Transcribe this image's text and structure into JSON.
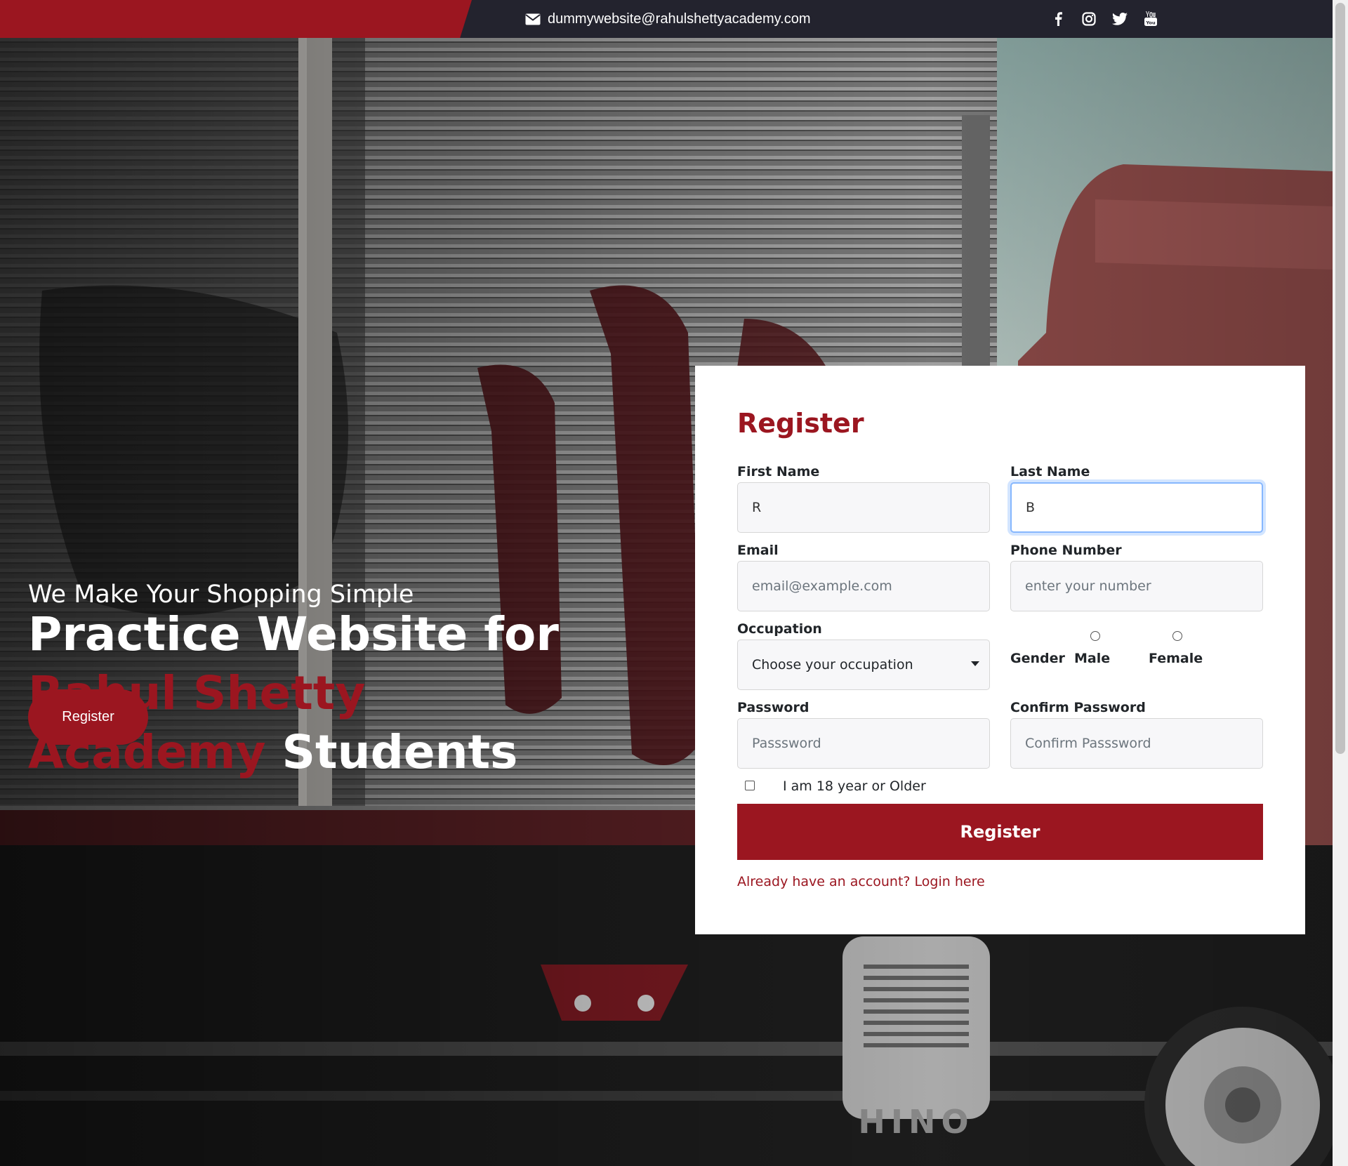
{
  "topbar": {
    "email": "dummywebsite@rahulshettyacademy.com",
    "socials": [
      "facebook",
      "instagram",
      "twitter",
      "youtube"
    ]
  },
  "hero": {
    "subtitle": "We Make Your Shopping Simple",
    "title_part1": "Practice Website for ",
    "title_accent": "Rahul Shetty Academy",
    "title_part2": " Students",
    "register_button": "Register"
  },
  "form": {
    "title": "Register",
    "first_name_label": "First Name",
    "first_name_value": "R",
    "last_name_label": "Last Name",
    "last_name_value": "B",
    "email_label": "Email",
    "email_placeholder": "email@example.com",
    "phone_label": "Phone Number",
    "phone_placeholder": "enter your number",
    "occupation_label": "Occupation",
    "occupation_selected": "Choose your occupation",
    "gender_label": "Gender",
    "gender_options": [
      "Male",
      "Female"
    ],
    "password_label": "Password",
    "password_placeholder": "Passsword",
    "confirm_password_label": "Confirm Password",
    "confirm_password_placeholder": "Confirm Passsword",
    "age_checkbox_label": "I am 18 year or Older",
    "submit_label": "Register",
    "login_link": "Already have an account? Login here"
  },
  "colors": {
    "brand_red": "#9b1620",
    "topbar_dark": "#23232e"
  }
}
